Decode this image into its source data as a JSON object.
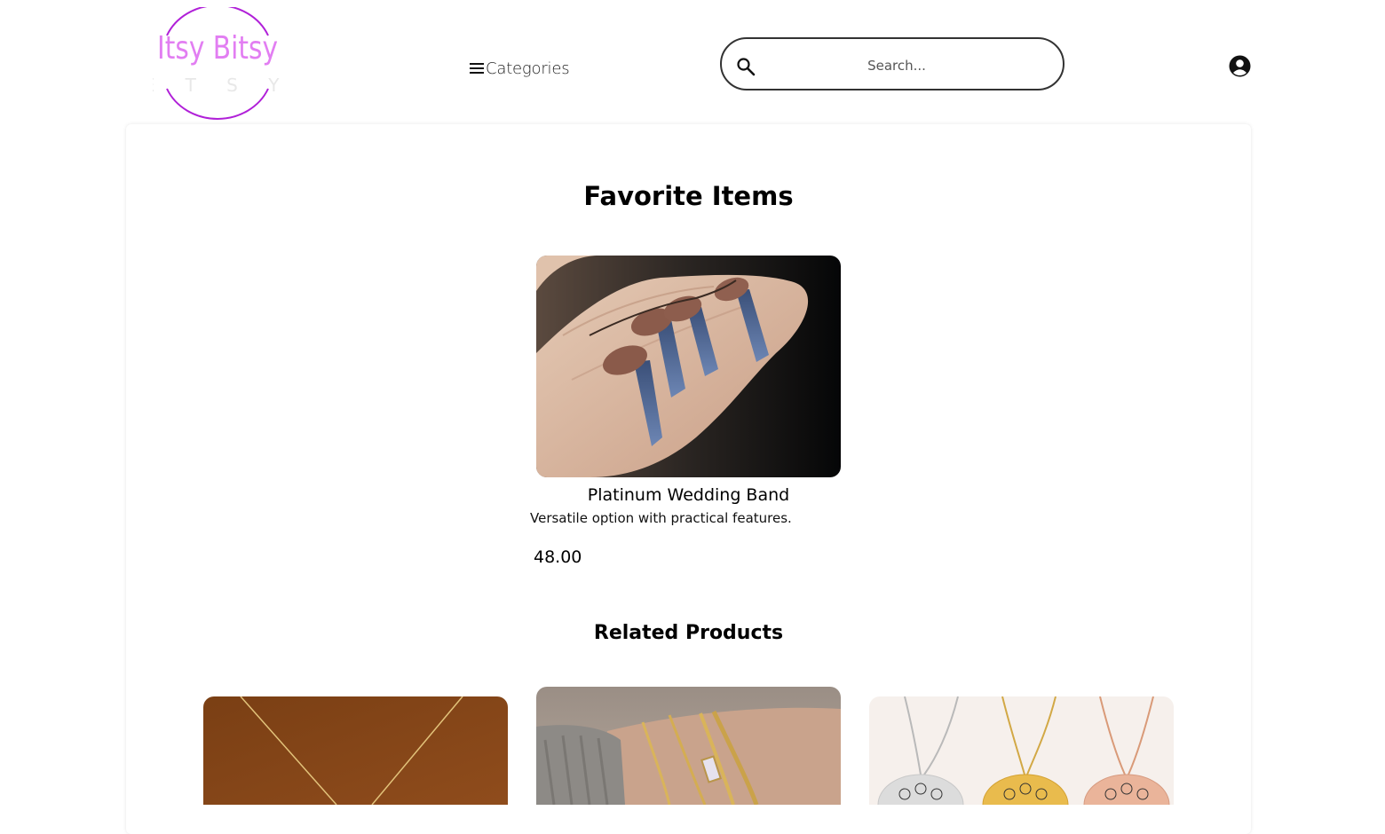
{
  "header": {
    "logo": {
      "title": "Itsy Bitsy",
      "subtitle": "E T S Y"
    },
    "categories_label": "Categories",
    "search": {
      "placeholder": "Search...",
      "value": ""
    }
  },
  "main": {
    "favorites_title": "Favorite Items",
    "favorite_item": {
      "name": "Platinum Wedding Band",
      "description": "Versatile option with practical features.",
      "price": "48.00"
    },
    "related_title": "Related Products"
  },
  "icons": {
    "menu": "hamburger-menu-icon",
    "search": "search-icon",
    "user": "user-account-icon"
  },
  "colors": {
    "logo_ring": "#b020d8",
    "logo_text": "#e27ef2"
  }
}
